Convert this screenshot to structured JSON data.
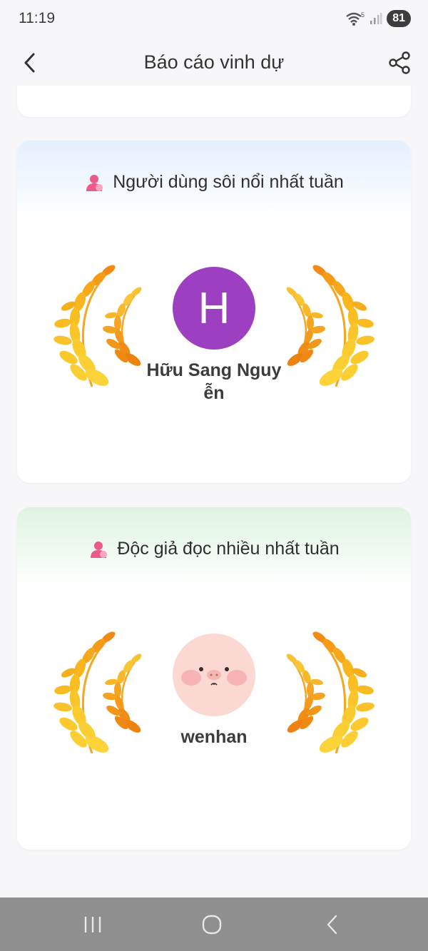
{
  "status": {
    "time": "11:19",
    "battery": "81",
    "wifi_label": "5"
  },
  "header": {
    "title": "Báo cáo vinh dự"
  },
  "cards": [
    {
      "title": "Người dùng sôi nổi nhất tuần",
      "avatar_letter": "H",
      "name": "Hữu Sang Nguyễn"
    },
    {
      "title": "Độc giả đọc nhiều nhất tuần",
      "name": "wenhan"
    }
  ],
  "colors": {
    "avatar_purple": "#9c3fc0",
    "laurel_gold": "#f7b81d",
    "laurel_orange": "#f08a14",
    "user_icon_pink": "#ec5a8b"
  },
  "icons": [
    "back-arrow-icon",
    "share-icon",
    "user-icon",
    "laurel-icon",
    "recent-apps-icon",
    "home-icon",
    "nav-back-icon"
  ]
}
